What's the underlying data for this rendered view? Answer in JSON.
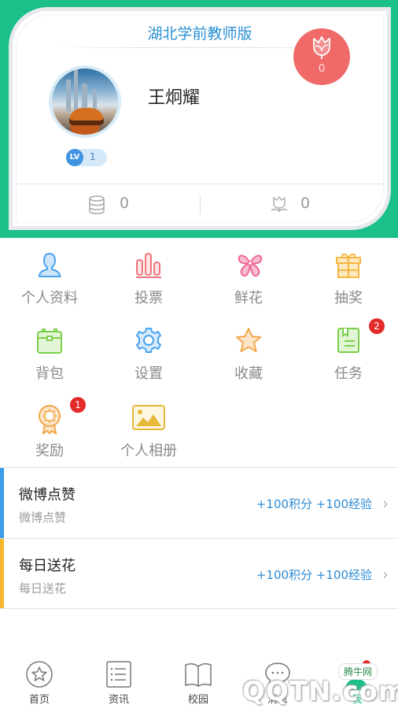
{
  "header": {
    "app_title": "湖北学前教师版",
    "username": "王炯耀",
    "level_label": "LV",
    "level": "1",
    "flower_count": "0",
    "coins": "0",
    "received_flowers": "0",
    "brand_color": "#1bbf8a",
    "flower_button_color": "#ef6a68"
  },
  "menu": [
    {
      "label": "个人资料",
      "icon": "person-icon",
      "color": "#4aa3f0"
    },
    {
      "label": "投票",
      "icon": "bar-chart-icon",
      "color": "#f0757a"
    },
    {
      "label": "鲜花",
      "icon": "flower-icon",
      "color": "#ee6b93"
    },
    {
      "label": "抽奖",
      "icon": "gift-icon",
      "color": "#f6b640"
    },
    {
      "label": "背包",
      "icon": "backpack-icon",
      "color": "#7ccf4c"
    },
    {
      "label": "设置",
      "icon": "gear-icon",
      "color": "#4aa3f0"
    },
    {
      "label": "收藏",
      "icon": "star-icon",
      "color": "#f0a64a"
    },
    {
      "label": "任务",
      "icon": "task-book-icon",
      "color": "#7ccf4c",
      "badge": "2"
    },
    {
      "label": "奖励",
      "icon": "medal-icon",
      "color": "#f0a64a",
      "badge": "1"
    },
    {
      "label": "个人相册",
      "icon": "photo-album-icon",
      "color": "#e8b83a"
    }
  ],
  "tasks": [
    {
      "title": "微博点赞",
      "subtitle": "微博点赞",
      "reward": "+100积分 +100经验",
      "accent": "#3d9be9"
    },
    {
      "title": "每日送花",
      "subtitle": "每日送花",
      "reward": "+100积分 +100经验",
      "accent": "#f5b72e"
    }
  ],
  "tabbar": [
    {
      "label": "首页",
      "icon": "home-star-icon"
    },
    {
      "label": "资讯",
      "icon": "news-list-icon"
    },
    {
      "label": "校园",
      "icon": "campus-book-icon"
    },
    {
      "label": "消息",
      "icon": "message-bubble-icon"
    },
    {
      "label": "我",
      "icon": "me-person-icon",
      "active": true,
      "has_dot": true
    }
  ],
  "watermark": {
    "text_cn": "腾牛网",
    "text": "QQTN.com"
  }
}
